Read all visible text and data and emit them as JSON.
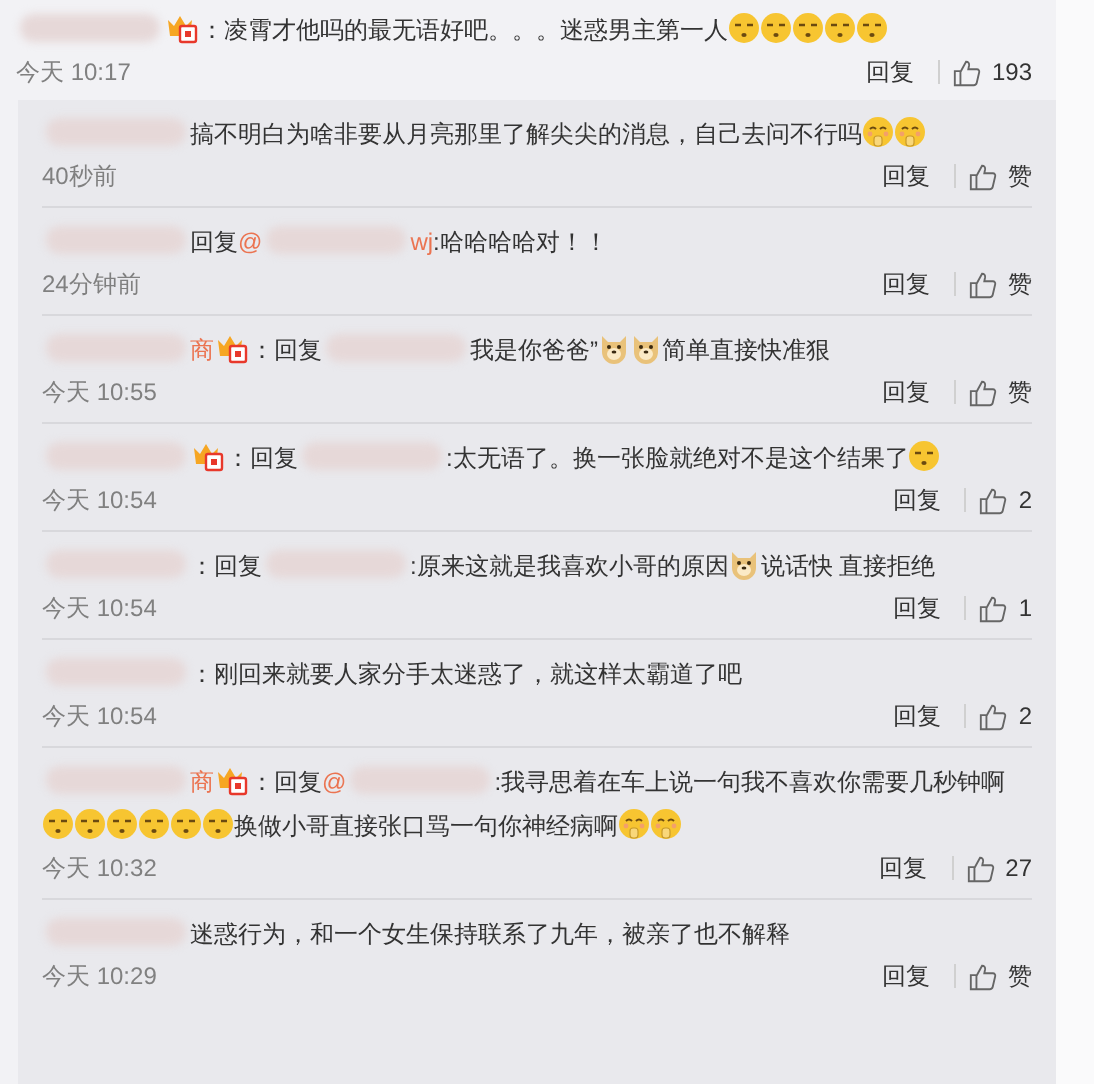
{
  "comment": {
    "parts": [
      {
        "kind": "redacted"
      },
      {
        "kind": "badge"
      },
      {
        "kind": "text",
        "text": "：凌霄才他吗的最无语好吧。。。迷惑男主第一人"
      },
      {
        "kind": "sleepy"
      },
      {
        "kind": "sleepy"
      },
      {
        "kind": "sleepy"
      },
      {
        "kind": "sleepy"
      },
      {
        "kind": "sleepy"
      }
    ],
    "time": "今天 10:17",
    "reply_label": "回复",
    "likes": "193"
  },
  "replies": [
    {
      "parts": [
        {
          "kind": "redacted"
        },
        {
          "kind": "text",
          "text": "搞不明白为啥非要从月亮那里了解尖尖的消息，自己去问不行吗"
        },
        {
          "kind": "shy"
        },
        {
          "kind": "shy"
        }
      ],
      "time": "40秒前",
      "reply_label": "回复",
      "likes": "赞"
    },
    {
      "parts": [
        {
          "kind": "redacted"
        },
        {
          "kind": "text",
          "text": "回复"
        },
        {
          "kind": "mention",
          "text": "@"
        },
        {
          "kind": "redacted"
        },
        {
          "kind": "mention",
          "text": "wj"
        },
        {
          "kind": "text",
          "text": ":哈哈哈哈对！！"
        }
      ],
      "time": "24分钟前",
      "reply_label": "回复",
      "likes": "赞"
    },
    {
      "parts": [
        {
          "kind": "redacted"
        },
        {
          "kind": "mention",
          "text": "商"
        },
        {
          "kind": "badge"
        },
        {
          "kind": "text",
          "text": "：回复"
        },
        {
          "kind": "redacted"
        },
        {
          "kind": "text",
          "text": "我是你爸爸”"
        },
        {
          "kind": "doge"
        },
        {
          "kind": "doge"
        },
        {
          "kind": "text",
          "text": "简单直接快准狠"
        }
      ],
      "time": "今天 10:55",
      "reply_label": "回复",
      "likes": "赞"
    },
    {
      "parts": [
        {
          "kind": "redacted"
        },
        {
          "kind": "badge"
        },
        {
          "kind": "text",
          "text": "：回复"
        },
        {
          "kind": "redacted"
        },
        {
          "kind": "text",
          "text": ":太无语了。换一张脸就绝对不是这个结果了"
        },
        {
          "kind": "sleepy"
        }
      ],
      "time": "今天 10:54",
      "reply_label": "回复",
      "likes": "2"
    },
    {
      "parts": [
        {
          "kind": "redacted"
        },
        {
          "kind": "text",
          "text": "：回复"
        },
        {
          "kind": "redacted"
        },
        {
          "kind": "text",
          "text": ":原来这就是我喜欢小哥的原因"
        },
        {
          "kind": "doge"
        },
        {
          "kind": "text",
          "text": "说话快 直接拒绝"
        }
      ],
      "time": "今天 10:54",
      "reply_label": "回复",
      "likes": "1"
    },
    {
      "parts": [
        {
          "kind": "redacted"
        },
        {
          "kind": "text",
          "text": "：刚回来就要人家分手太迷惑了，就这样太霸道了吧"
        }
      ],
      "time": "今天 10:54",
      "reply_label": "回复",
      "likes": "2"
    },
    {
      "parts": [
        {
          "kind": "redacted"
        },
        {
          "kind": "mention",
          "text": "商"
        },
        {
          "kind": "badge"
        },
        {
          "kind": "text",
          "text": "：回复"
        },
        {
          "kind": "mention",
          "text": "@"
        },
        {
          "kind": "redacted"
        },
        {
          "kind": "text",
          "text": ":我寻思着在车上说一句我不喜欢你需要几秒钟啊"
        },
        {
          "kind": "sleepy"
        },
        {
          "kind": "sleepy"
        },
        {
          "kind": "sleepy"
        },
        {
          "kind": "sleepy"
        },
        {
          "kind": "sleepy"
        },
        {
          "kind": "sleepy"
        },
        {
          "kind": "text",
          "text": "换做小哥直接张口骂一句你神经病啊"
        },
        {
          "kind": "shy"
        },
        {
          "kind": "shy"
        }
      ],
      "time": "今天 10:32",
      "reply_label": "回复",
      "likes": "27"
    },
    {
      "parts": [
        {
          "kind": "redacted"
        },
        {
          "kind": "text",
          "text": "迷惑行为，和一个女生保持联系了九年，被亲了也不解释"
        }
      ],
      "time": "今天 10:29",
      "reply_label": "回复",
      "likes": "赞"
    }
  ]
}
